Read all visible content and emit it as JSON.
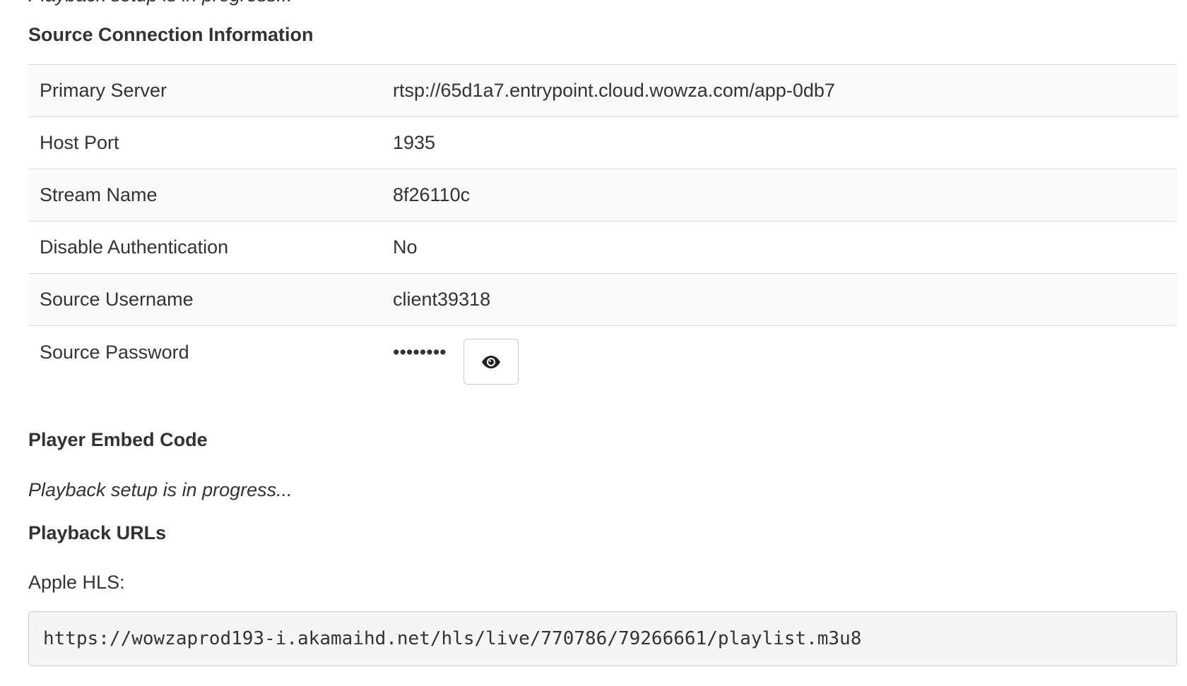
{
  "top_text": "Playback setup is in progress...",
  "source_connection": {
    "title": "Source Connection Information",
    "rows": [
      {
        "label": "Primary Server",
        "value": "rtsp://65d1a7.entrypoint.cloud.wowza.com/app-0db7"
      },
      {
        "label": "Host Port",
        "value": "1935"
      },
      {
        "label": "Stream Name",
        "value": "8f26110c"
      },
      {
        "label": "Disable Authentication",
        "value": "No"
      },
      {
        "label": "Source Username",
        "value": "client39318"
      },
      {
        "label": "Source Password",
        "value": "••••••••"
      }
    ],
    "password_toggle_icon": "eye-icon"
  },
  "player_embed": {
    "title": "Player Embed Code",
    "status": "Playback setup is in progress..."
  },
  "playback_urls": {
    "title": "Playback URLs",
    "apple_hls_label": "Apple HLS:",
    "apple_hls_url": "https://wowzaprod193-i.akamaihd.net/hls/live/770786/79266661/playlist.m3u8"
  },
  "colors": {
    "text": "#333333",
    "row_stripe": "#f9f9f9",
    "border": "#dddddd",
    "code_bg": "#f5f5f5"
  }
}
